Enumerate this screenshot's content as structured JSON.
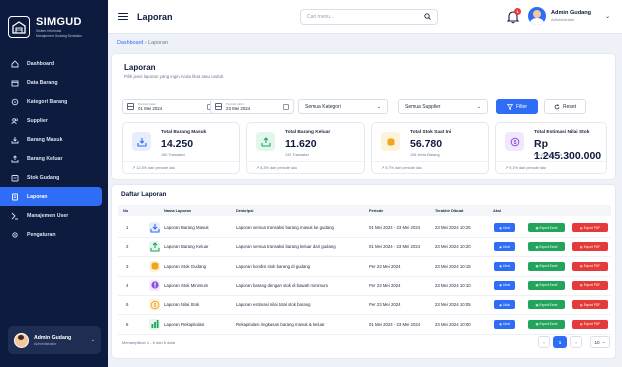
{
  "brand": {
    "title": "SIMGUD",
    "subtitle_line1": "Sistem Informasi",
    "subtitle_line2": "Manajemen Gudang Sembako"
  },
  "sidebar": {
    "items": [
      {
        "label": "Dashboard",
        "icon": "home-icon",
        "active": false
      },
      {
        "label": "Data Barang",
        "icon": "box-icon",
        "active": false
      },
      {
        "label": "Kategori Barang",
        "icon": "tag-icon",
        "active": false
      },
      {
        "label": "Supplier",
        "icon": "users-icon",
        "active": false
      },
      {
        "label": "Barang Masuk",
        "icon": "download-icon",
        "active": false
      },
      {
        "label": "Barang Keluar",
        "icon": "upload-icon",
        "active": false
      },
      {
        "label": "Stok Gudang",
        "icon": "warehouse-icon",
        "active": false
      },
      {
        "label": "Laporan",
        "icon": "report-icon",
        "active": true
      },
      {
        "label": "Manajemen User",
        "icon": "user-cog-icon",
        "active": false
      },
      {
        "label": "Pengaturan",
        "icon": "gear-icon",
        "active": false
      }
    ],
    "user": {
      "name": "Admin Gudang",
      "role": "Administrator"
    }
  },
  "topbar": {
    "title": "Laporan",
    "search_placeholder": "Cari menu...",
    "notif_count": "1",
    "user_name": "Admin Gudang",
    "user_role": "Administrator"
  },
  "breadcrumb": {
    "first": "Dashboard",
    "sep": "›",
    "current": "Laporan"
  },
  "header": {
    "title": "Laporan",
    "subtitle": "Pilih jenis laporan yang ingin Anda lihat atau unduh."
  },
  "filters": {
    "start_label": "Periode Awal",
    "start_value": "01 Mei 2024",
    "end_label": "Periode Akhir",
    "end_value": "23 Mei 2024",
    "category": "Semua Kategori",
    "supplier": "Semua Supplier",
    "filter_label": "Filter",
    "reset_label": "Reset"
  },
  "stats": [
    {
      "label": "Total Barang Masuk",
      "value": "14.250",
      "sub": "150 Transaksi",
      "trend": "12,5% dari periode lalu",
      "icon": "inbox-icon",
      "color": "#2f6df6",
      "bg": "#e6eefe"
    },
    {
      "label": "Total Barang Keluar",
      "value": "11.620",
      "sub": "132 Transaksi",
      "trend": "8,3% dari periode lalu",
      "icon": "outbox-icon",
      "color": "#22a45d",
      "bg": "#e3f6ec"
    },
    {
      "label": "Total Stok Saat Ini",
      "value": "56.780",
      "sub": "126 Jenis Barang",
      "trend": "5,7% dari periode lalu",
      "icon": "coins-icon",
      "color": "#f0a71f",
      "bg": "#fdf2dc"
    },
    {
      "label": "Total Estimasi Nilai Stok",
      "value": "Rp 1.245.300.000",
      "sub": "Per 23 Mei 2024",
      "trend": "9,1% dari periode lalu",
      "icon": "money-icon",
      "color": "#8a4de0",
      "bg": "#f1e8fd"
    }
  ],
  "table": {
    "title": "Daftar Laporan",
    "headers": [
      "No",
      "Nama Laporan",
      "Deskripsi",
      "Periode",
      "Terakhir Dibuat",
      "Aksi"
    ],
    "rows": [
      {
        "no": "1",
        "name": "Laporan Barang Masuk",
        "desc": "Laporan semua transaksi barang masuk ke gudang",
        "period": "01 Mei 2024 - 23 Mei 2024",
        "last": "23 Mei 2024 10:25",
        "icon": "inbox-icon",
        "color": "#2f6df6",
        "bg": "#e6eefe"
      },
      {
        "no": "2",
        "name": "Laporan Barang Keluar",
        "desc": "Laporan semua transaksi barang keluar dari gudang",
        "period": "01 Mei 2024 - 23 Mei 2024",
        "last": "23 Mei 2024 10:20",
        "icon": "outbox-icon",
        "color": "#22a45d",
        "bg": "#e3f6ec"
      },
      {
        "no": "3",
        "name": "Laporan Stok Gudang",
        "desc": "Laporan kondisi stok barang di gudang",
        "period": "Per 23 Mei 2024",
        "last": "23 Mei 2024 10:15",
        "icon": "coins-icon",
        "color": "#f0a71f",
        "bg": "#fdf2dc"
      },
      {
        "no": "4",
        "name": "Laporan Stok Minimum",
        "desc": "Laporan barang dengan stok di bawah minimum",
        "period": "Per 23 Mei 2024",
        "last": "23 Mei 2024 10:10",
        "icon": "alert-icon",
        "color": "#8a4de0",
        "bg": "#f1e8fd"
      },
      {
        "no": "5",
        "name": "Laporan Nilai Stok",
        "desc": "Laporan estimasi nilai total stok barang",
        "period": "Per 23 Mei 2024",
        "last": "23 Mei 2024 10:05",
        "icon": "money-icon",
        "color": "#f0a71f",
        "bg": "#fdf2dc"
      },
      {
        "no": "6",
        "name": "Laporan Rekapitulasi",
        "desc": "Rekapitulasi ringkasan barang masuk & keluar",
        "period": "01 Mei 2024 - 23 Mei 2024",
        "last": "23 Mei 2024 10:00",
        "icon": "chart-icon",
        "color": "#22a45d",
        "bg": "#e3f6ec"
      }
    ],
    "view_label": "Lihat",
    "excel_label": "Export Excel",
    "pdf_label": "Export PDF"
  },
  "footer": {
    "info": "Menampilkan 1 - 6 dari 6 data",
    "page": "1",
    "page_size": "10"
  }
}
